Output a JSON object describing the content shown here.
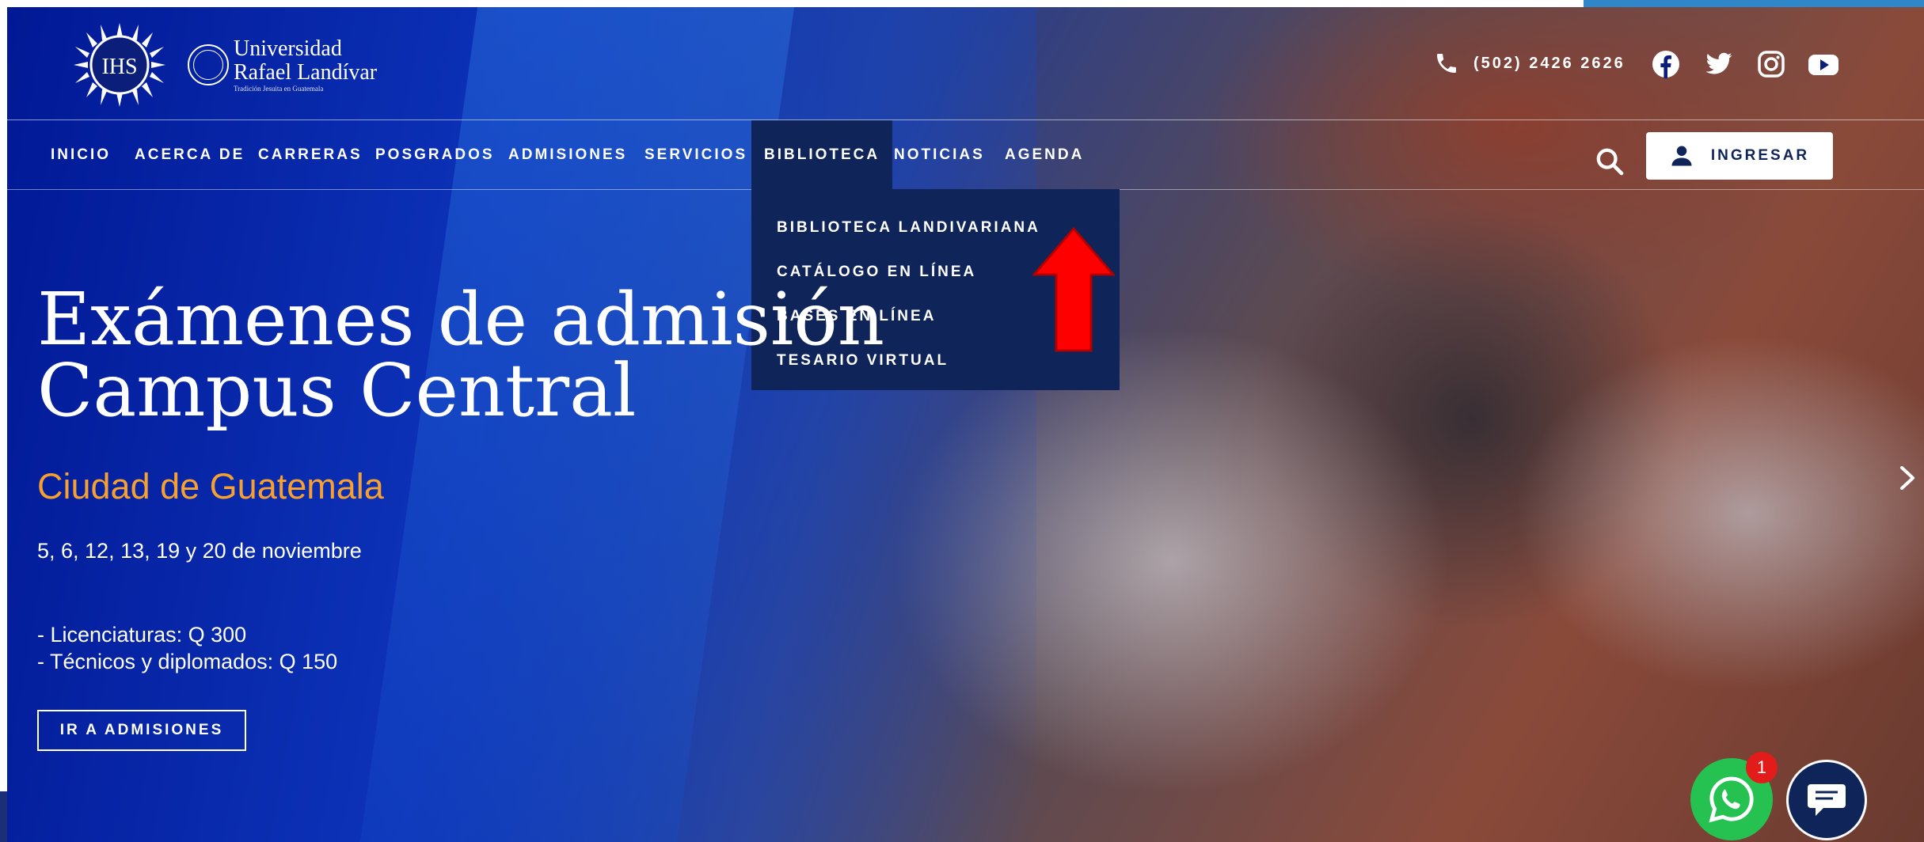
{
  "brand": {
    "ihs_text": "IHS",
    "university_line1": "Universidad",
    "university_line2": "Rafael Landívar",
    "university_tagline": "Tradición Jesuita en Guatemala"
  },
  "contact": {
    "phone": "(502) 2426 2626",
    "social": [
      "facebook-icon",
      "twitter-icon",
      "instagram-icon",
      "youtube-icon"
    ]
  },
  "nav": {
    "items": [
      {
        "label": "INICIO"
      },
      {
        "label": "ACERCA DE"
      },
      {
        "label": "CARRERAS"
      },
      {
        "label": "POSGRADOS"
      },
      {
        "label": "ADMISIONES"
      },
      {
        "label": "SERVICIOS"
      },
      {
        "label": "BIBLIOTECA",
        "active": true
      },
      {
        "label": "NOTICIAS"
      },
      {
        "label": "AGENDA"
      }
    ],
    "login_label": "INGRESAR"
  },
  "dropdown": {
    "parent": "BIBLIOTECA",
    "items": [
      {
        "label": "BIBLIOTECA LANDIVARIANA"
      },
      {
        "label": "CATÁLOGO EN LÍNEA"
      },
      {
        "label": "BASES EN LÍNEA"
      },
      {
        "label": "TESARIO VIRTUAL"
      }
    ]
  },
  "hero": {
    "title_line1": "Exámenes de admisión",
    "title_line2": "Campus Central",
    "subtitle": "Ciudad de Guatemala",
    "dates": "5, 6, 12, 13, 19 y 20 de noviembre",
    "price_line1": "- Licenciaturas: Q 300",
    "price_line2": "- Técnicos y diplomados: Q 150",
    "cta_label": "IR A ADMISIONES"
  },
  "floating": {
    "whatsapp_badge": "1"
  },
  "colors": {
    "navy": "#0f2459",
    "accent_orange": "#f5a031",
    "whatsapp_green": "#25c251",
    "badge_red": "#e21b1b",
    "annotation_red": "#ff0000"
  }
}
